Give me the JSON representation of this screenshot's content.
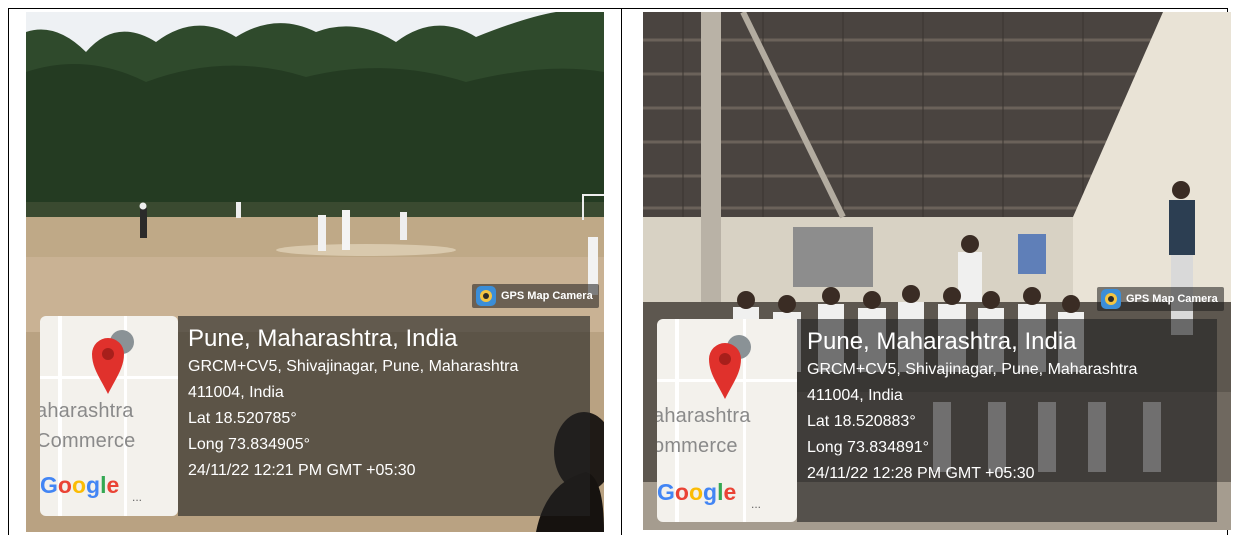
{
  "photos": [
    {
      "badge": "GPS Map Camera",
      "place": "Pune, Maharashtra, India",
      "address": "GRCM+CV5, Shivajinagar, Pune, Maharashtra",
      "postal": "411004, India",
      "lat": "Lat 18.520785°",
      "long": "Long 73.834905°",
      "datetime": "24/11/22 12:21 PM GMT +05:30",
      "map": {
        "label1": "aharashtra",
        "label2": "Commerce",
        "logo": "Google",
        "dots": "..."
      }
    },
    {
      "badge": "GPS Map Camera",
      "place": "Pune, Maharashtra, India",
      "address": "GRCM+CV5, Shivajinagar, Pune, Maharashtra",
      "postal": "411004, India",
      "lat": "Lat 18.520883°",
      "long": "Long 73.834891°",
      "datetime": "24/11/22 12:28 PM GMT +05:30",
      "map": {
        "label1": "aharashtra",
        "label2": "ommerce",
        "logo": "Google",
        "dots": "..."
      }
    }
  ],
  "icons": [
    "gps-map-camera-icon",
    "map-pin-icon"
  ],
  "colors": {
    "pin": "#e0312c",
    "overlay": "#232323"
  }
}
